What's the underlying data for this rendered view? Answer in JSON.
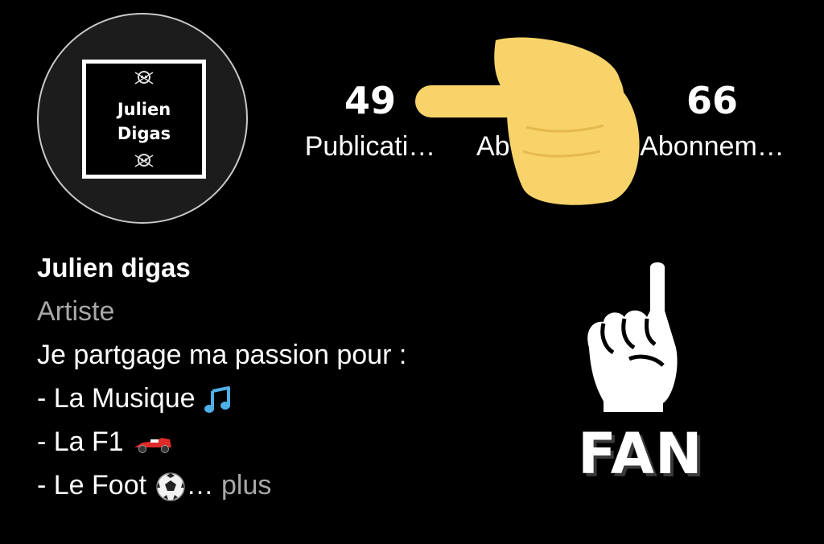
{
  "profile": {
    "avatar_text_line1": "Julien",
    "avatar_text_line2": "Digas",
    "display_name": "Julien digas",
    "category": "Artiste"
  },
  "stats": {
    "posts": {
      "count": "49",
      "label": "Publicati…"
    },
    "followers": {
      "label": "Ab"
    },
    "following": {
      "count": "66",
      "label": "Abonnem…"
    }
  },
  "bio": {
    "line1": "Je partgage ma passion pour :",
    "line2": "- La Musique",
    "line3": "- La F1",
    "line4": "- Le Foot",
    "ellipsis": "…",
    "more": "plus"
  },
  "overlay": {
    "fan_text": "FAN",
    "pointing_hand_color": "#f7d36a"
  },
  "icons": [
    "skull-emblem-icon",
    "music-note-icon",
    "race-car-icon",
    "soccer-ball-icon",
    "pointing-hand-icon",
    "foam-finger-icon"
  ]
}
